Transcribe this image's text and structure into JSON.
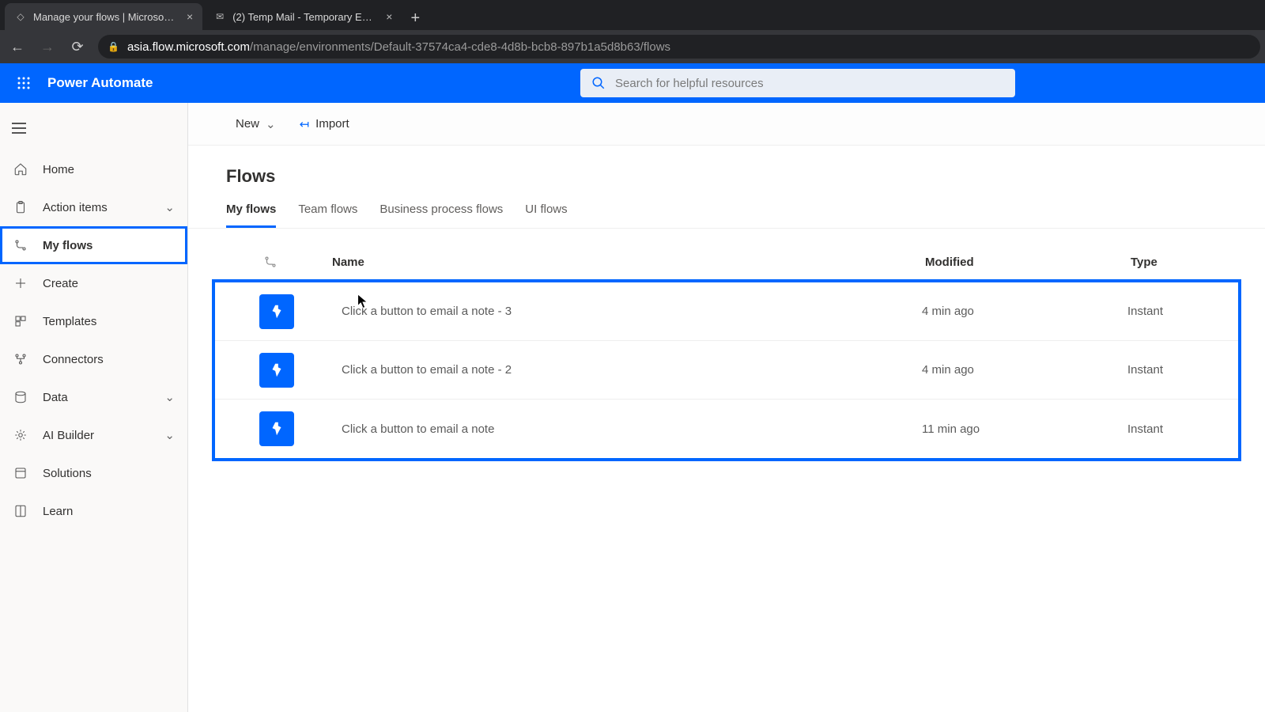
{
  "browser": {
    "tabs": [
      {
        "title": "Manage your flows | Microsoft P",
        "active": true
      },
      {
        "title": "(2) Temp Mail - Temporary Email",
        "active": false
      }
    ],
    "url_domain": "asia.flow.microsoft.com",
    "url_path": "/manage/environments/Default-37574ca4-cde8-4d8b-bcb8-897b1a5d8b63/flows"
  },
  "header": {
    "brand": "Power Automate",
    "search_placeholder": "Search for helpful resources"
  },
  "sidebar": {
    "items": [
      {
        "key": "home",
        "label": "Home"
      },
      {
        "key": "action-items",
        "label": "Action items",
        "expandable": true
      },
      {
        "key": "my-flows",
        "label": "My flows",
        "active": true,
        "highlight": true
      },
      {
        "key": "create",
        "label": "Create"
      },
      {
        "key": "templates",
        "label": "Templates"
      },
      {
        "key": "connectors",
        "label": "Connectors"
      },
      {
        "key": "data",
        "label": "Data",
        "expandable": true
      },
      {
        "key": "ai-builder",
        "label": "AI Builder",
        "expandable": true
      },
      {
        "key": "solutions",
        "label": "Solutions"
      },
      {
        "key": "learn",
        "label": "Learn"
      }
    ]
  },
  "commandbar": {
    "new_label": "New",
    "import_label": "Import"
  },
  "page": {
    "title": "Flows",
    "tabs": [
      {
        "label": "My flows",
        "active": true
      },
      {
        "label": "Team flows"
      },
      {
        "label": "Business process flows"
      },
      {
        "label": "UI flows"
      }
    ],
    "columns": {
      "name": "Name",
      "modified": "Modified",
      "type": "Type"
    },
    "rows": [
      {
        "name": "Click a button to email a note - 3",
        "modified": "4 min ago",
        "type": "Instant"
      },
      {
        "name": "Click a button to email a note - 2",
        "modified": "4 min ago",
        "type": "Instant"
      },
      {
        "name": "Click a button to email a note",
        "modified": "11 min ago",
        "type": "Instant"
      }
    ]
  }
}
